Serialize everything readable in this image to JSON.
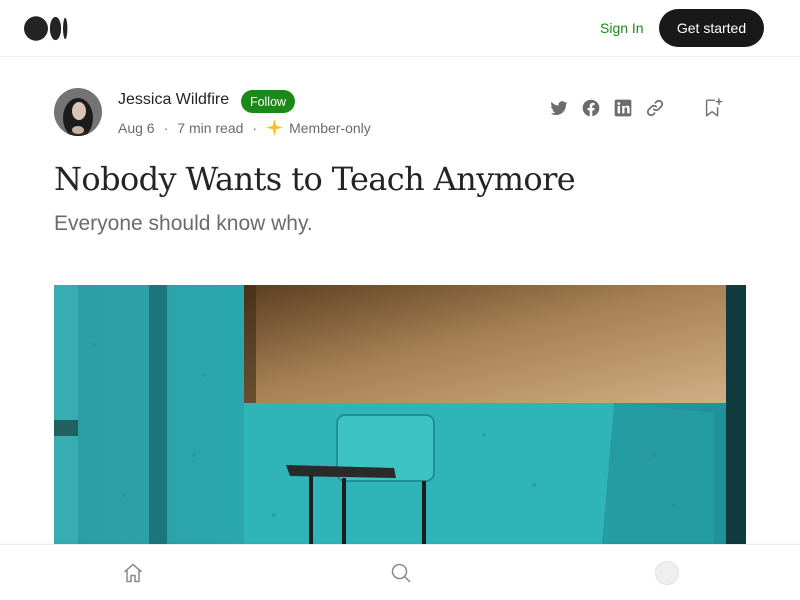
{
  "header": {
    "logo_icon": "medium-logo-icon",
    "sign_in_label": "Sign In",
    "get_started_label": "Get started"
  },
  "author": {
    "name": "Jessica Wildfire",
    "follow_label": "Follow",
    "date": "Aug 6",
    "read_time": "7 min read",
    "member_label": "Member-only",
    "separator": "·"
  },
  "share": {
    "icons": [
      "twitter-icon",
      "facebook-icon",
      "linkedin-icon",
      "link-icon",
      "bookmark-add-icon"
    ]
  },
  "article": {
    "title": "Nobody Wants to Teach Anymore",
    "subtitle": "Everyone should know why."
  },
  "bottom_nav": {
    "icons": [
      "home-icon",
      "search-icon",
      "profile-avatar"
    ]
  },
  "colors": {
    "brand_green": "#1a8917",
    "dark_button": "#191919",
    "text_primary": "#242424",
    "text_secondary": "#6b6b6b",
    "member_star": "#ffc017",
    "hero_teal": "#2aa8ad",
    "hero_wall": "#a9885d"
  }
}
